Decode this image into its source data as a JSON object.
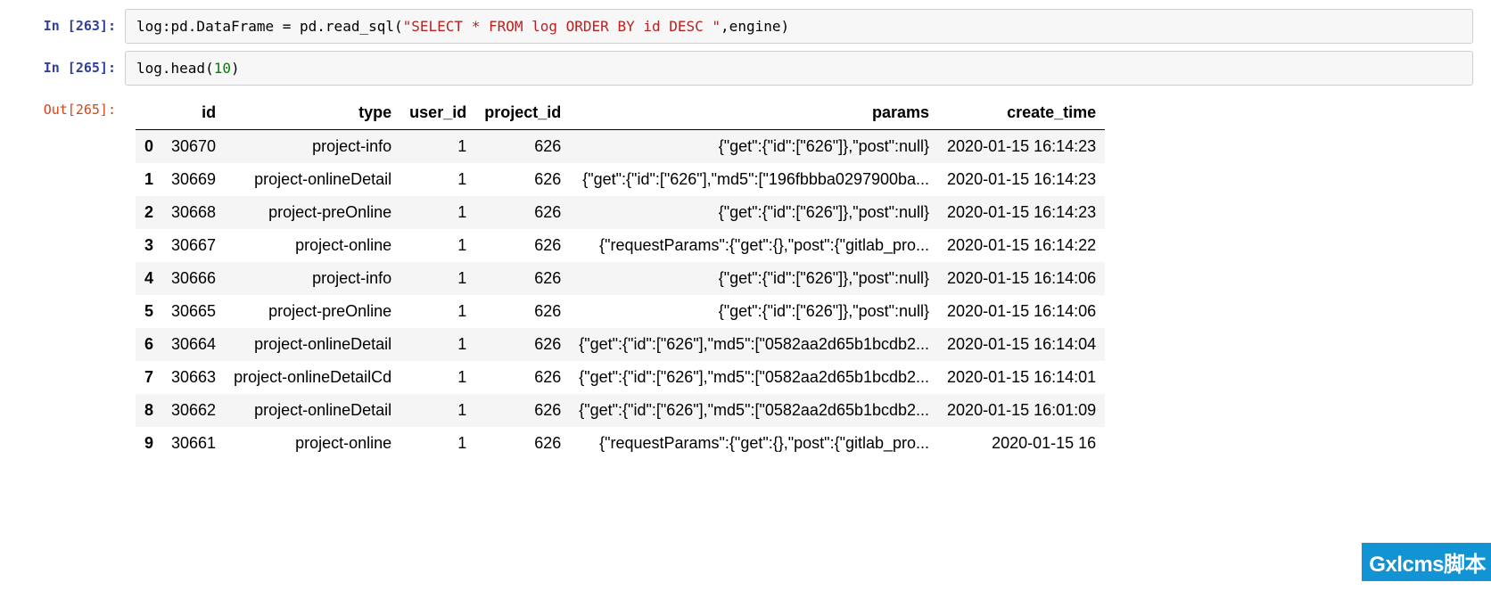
{
  "cells": {
    "in263": {
      "prompt": "In [263]:"
    },
    "in265": {
      "prompt": "In [265]:"
    },
    "out265": {
      "prompt": "Out[265]:"
    }
  },
  "code263": {
    "p1": "log:pd.DataFrame = pd.read_sql(",
    "str": "\"SELECT * FROM log ORDER BY id DESC \"",
    "p2": ",engine)"
  },
  "code265": {
    "p1": "log.head(",
    "num": "10",
    "p2": ")"
  },
  "table": {
    "columns": [
      "id",
      "type",
      "user_id",
      "project_id",
      "params",
      "create_time"
    ],
    "rows": [
      {
        "idx": "0",
        "id": "30670",
        "type": "project-info",
        "user_id": "1",
        "project_id": "626",
        "params": "{\"get\":{\"id\":[\"626\"]},\"post\":null}",
        "create_time": "2020-01-15 16:14:23"
      },
      {
        "idx": "1",
        "id": "30669",
        "type": "project-onlineDetail",
        "user_id": "1",
        "project_id": "626",
        "params": "{\"get\":{\"id\":[\"626\"],\"md5\":[\"196fbbba0297900ba...",
        "create_time": "2020-01-15 16:14:23"
      },
      {
        "idx": "2",
        "id": "30668",
        "type": "project-preOnline",
        "user_id": "1",
        "project_id": "626",
        "params": "{\"get\":{\"id\":[\"626\"]},\"post\":null}",
        "create_time": "2020-01-15 16:14:23"
      },
      {
        "idx": "3",
        "id": "30667",
        "type": "project-online",
        "user_id": "1",
        "project_id": "626",
        "params": "{\"requestParams\":{\"get\":{},\"post\":{\"gitlab_pro...",
        "create_time": "2020-01-15 16:14:22"
      },
      {
        "idx": "4",
        "id": "30666",
        "type": "project-info",
        "user_id": "1",
        "project_id": "626",
        "params": "{\"get\":{\"id\":[\"626\"]},\"post\":null}",
        "create_time": "2020-01-15 16:14:06"
      },
      {
        "idx": "5",
        "id": "30665",
        "type": "project-preOnline",
        "user_id": "1",
        "project_id": "626",
        "params": "{\"get\":{\"id\":[\"626\"]},\"post\":null}",
        "create_time": "2020-01-15 16:14:06"
      },
      {
        "idx": "6",
        "id": "30664",
        "type": "project-onlineDetail",
        "user_id": "1",
        "project_id": "626",
        "params": "{\"get\":{\"id\":[\"626\"],\"md5\":[\"0582aa2d65b1bcdb2...",
        "create_time": "2020-01-15 16:14:04"
      },
      {
        "idx": "7",
        "id": "30663",
        "type": "project-onlineDetailCd",
        "user_id": "1",
        "project_id": "626",
        "params": "{\"get\":{\"id\":[\"626\"],\"md5\":[\"0582aa2d65b1bcdb2...",
        "create_time": "2020-01-15 16:14:01"
      },
      {
        "idx": "8",
        "id": "30662",
        "type": "project-onlineDetail",
        "user_id": "1",
        "project_id": "626",
        "params": "{\"get\":{\"id\":[\"626\"],\"md5\":[\"0582aa2d65b1bcdb2...",
        "create_time": "2020-01-15 16:01:09"
      },
      {
        "idx": "9",
        "id": "30661",
        "type": "project-online",
        "user_id": "1",
        "project_id": "626",
        "params": "{\"requestParams\":{\"get\":{},\"post\":{\"gitlab_pro...",
        "create_time": "2020-01-15 16"
      }
    ]
  },
  "watermark": "Gxlcms脚本"
}
